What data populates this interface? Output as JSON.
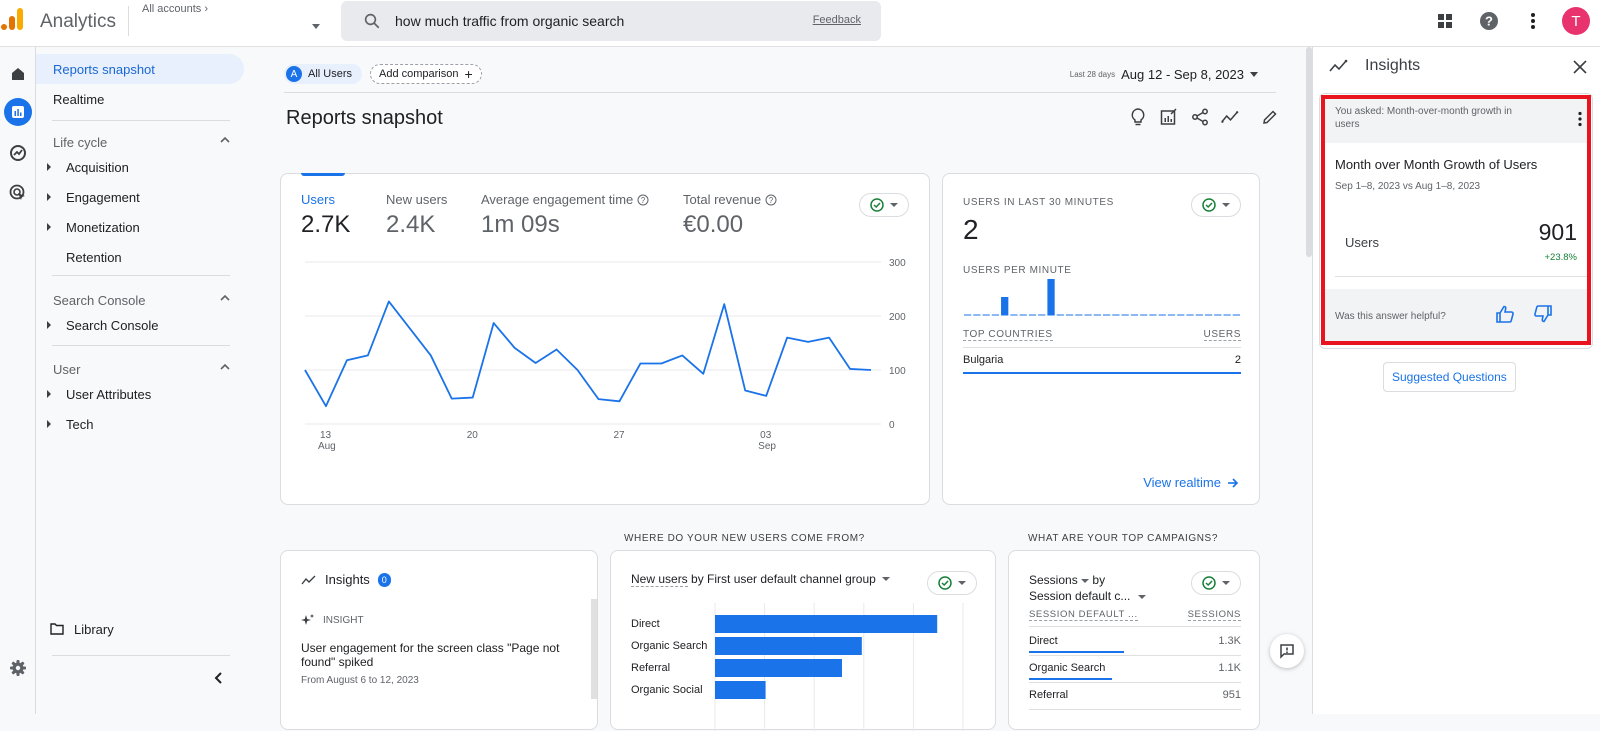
{
  "app": {
    "brand": "Analytics",
    "accounts_label": "All accounts",
    "logo_colors": [
      "#f9ab00",
      "#e37400"
    ]
  },
  "search": {
    "query": "how much traffic from organic search",
    "feedback_label": "Feedback"
  },
  "topbar": {
    "icons": [
      "apps-grid-icon",
      "help-icon",
      "more-vert-icon"
    ],
    "avatar_initial": "T",
    "avatar_color": "#e8336e"
  },
  "rail": {
    "items": [
      "home-icon",
      "reports-icon",
      "explore-icon",
      "advertising-icon"
    ],
    "settings_icon": "gear-icon"
  },
  "nav": {
    "top_items": [
      {
        "label": "Reports snapshot",
        "active": true
      },
      {
        "label": "Realtime",
        "active": false
      }
    ],
    "sections": [
      {
        "title": "Life cycle",
        "items": [
          "Acquisition",
          "Engagement",
          "Monetization",
          "Retention"
        ]
      },
      {
        "title": "Search Console",
        "items": [
          "Search Console"
        ]
      },
      {
        "title": "User",
        "items": [
          "User Attributes",
          "Tech"
        ]
      }
    ],
    "library_label": "Library"
  },
  "header": {
    "segment_letter": "A",
    "segment_label": "All Users",
    "add_comparison_label": "Add comparison",
    "date_preset": "Last 28 days",
    "date_range": "Aug 12 - Sep 8, 2023",
    "page_title": "Reports snapshot",
    "actions": [
      "insights-bulb-icon",
      "customize-report-icon",
      "share-icon",
      "insights-trend-icon",
      "edit-icon"
    ]
  },
  "kpis": [
    {
      "label": "Users",
      "value": "2.7K",
      "active": true,
      "help": false
    },
    {
      "label": "New users",
      "value": "2.4K",
      "active": false,
      "help": false
    },
    {
      "label": "Average engagement time",
      "value": "1m 09s",
      "active": false,
      "help": true
    },
    {
      "label": "Total revenue",
      "value": "€0.00",
      "active": false,
      "help": true
    }
  ],
  "chart_data": [
    {
      "type": "line",
      "title": "Users",
      "x": [
        "Aug 12",
        "Aug 13",
        "Aug 14",
        "Aug 15",
        "Aug 16",
        "Aug 17",
        "Aug 18",
        "Aug 19",
        "Aug 20",
        "Aug 21",
        "Aug 22",
        "Aug 23",
        "Aug 24",
        "Aug 25",
        "Aug 26",
        "Aug 27",
        "Aug 28",
        "Aug 29",
        "Aug 30",
        "Aug 31",
        "Sep 1",
        "Sep 2",
        "Sep 3",
        "Sep 4",
        "Sep 5",
        "Sep 6",
        "Sep 7",
        "Sep 8"
      ],
      "series": [
        {
          "name": "Users",
          "values": [
            100,
            33,
            118,
            127,
            227,
            177,
            127,
            47,
            49,
            187,
            141,
            113,
            138,
            100,
            46,
            42,
            112,
            112,
            127,
            93,
            222,
            62,
            52,
            160,
            152,
            160,
            102,
            100
          ]
        }
      ],
      "x_tick_labels": [
        {
          "day": "13",
          "month": "Aug"
        },
        {
          "day": "20",
          "month": ""
        },
        {
          "day": "27",
          "month": ""
        },
        {
          "day": "03",
          "month": "Sep"
        }
      ],
      "y_tick_labels": [
        "300",
        "200",
        "100",
        "0"
      ],
      "ylim": [
        0,
        300
      ],
      "grid": true,
      "color": "#1a73e8"
    },
    {
      "type": "bar",
      "title": "Users per minute",
      "values": [
        0,
        0,
        0,
        0,
        1,
        0,
        0,
        0,
        0,
        2,
        0,
        0,
        0,
        0,
        0,
        0,
        0,
        0,
        0,
        0,
        0,
        0,
        0,
        0,
        0,
        0,
        0,
        0,
        0,
        0
      ],
      "ylim": [
        0,
        2
      ],
      "color": "#1a73e8"
    },
    {
      "type": "bar",
      "orientation": "horizontal",
      "title": "New users by First user default channel group",
      "categories": [
        "Direct",
        "Organic Search",
        "Referral",
        "Organic Social"
      ],
      "values": [
        1120,
        740,
        640,
        255
      ],
      "xlim": [
        0,
        1250
      ],
      "grid": true,
      "color": "#1a73e8"
    }
  ],
  "realtime": {
    "title": "USERS IN LAST 30 MINUTES",
    "value": "2",
    "per_minute_label": "USERS PER MINUTE",
    "countries_header": "TOP COUNTRIES",
    "users_header": "USERS",
    "rows": [
      {
        "country": "Bulgaria",
        "users": "2"
      }
    ],
    "view_link": "View realtime"
  },
  "insights_card": {
    "title": "Insights",
    "count": "0",
    "tag": "INSIGHT",
    "text": "User engagement for the screen class \"Page not found\" spiked",
    "date": "From August 6 to 12, 2023"
  },
  "sections": {
    "new_users_q": "WHERE DO YOUR NEW USERS COME FROM?",
    "campaigns_q": "WHAT ARE YOUR TOP CAMPAIGNS?"
  },
  "new_users_card": {
    "metric": "New users",
    "rest": "by First user default channel group"
  },
  "campaigns_card": {
    "metric": "Sessions",
    "by": "by",
    "dimension": "Session default c...",
    "col_dim": "SESSION DEFAULT ...",
    "col_val": "SESSIONS",
    "rows": [
      {
        "name": "Direct",
        "value": "1.3K",
        "share": 0.45
      },
      {
        "name": "Organic Search",
        "value": "1.1K",
        "share": 0.39
      },
      {
        "name": "Referral",
        "value": "951",
        "share": 0.33
      }
    ]
  },
  "insights_panel": {
    "title": "Insights",
    "asked": "You asked: Month-over-month growth in users",
    "heading": "Month over Month Growth of Users",
    "period": "Sep 1–8, 2023 vs Aug 1–8, 2023",
    "metric_label": "Users",
    "metric_value": "901",
    "metric_delta": "+23.8%",
    "helpful_q": "Was this answer helpful?",
    "suggested_label": "Suggested Questions",
    "highlight_color": "#e8141e"
  }
}
